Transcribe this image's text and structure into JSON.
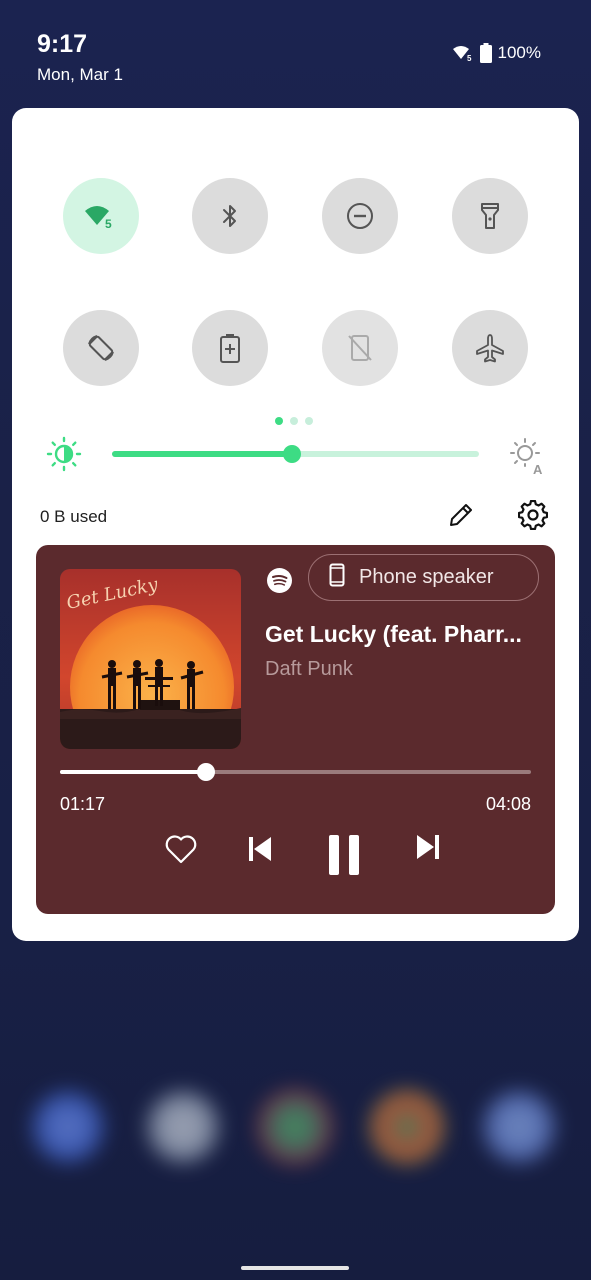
{
  "status_bar": {
    "time": "9:17",
    "date": "Mon, Mar 1",
    "battery": "100%",
    "wifi_badge": "5"
  },
  "quick_settings": {
    "tiles": [
      {
        "name": "wifi",
        "icon": "wifi-5-icon",
        "state": "active",
        "badge": "5"
      },
      {
        "name": "bluetooth",
        "icon": "bluetooth-icon",
        "state": "off"
      },
      {
        "name": "do-not-disturb",
        "icon": "do-not-disturb-icon",
        "state": "off"
      },
      {
        "name": "flashlight",
        "icon": "flashlight-icon",
        "state": "off"
      },
      {
        "name": "auto-rotate",
        "icon": "auto-rotate-icon",
        "state": "off"
      },
      {
        "name": "battery-saver",
        "icon": "battery-saver-icon",
        "state": "off"
      },
      {
        "name": "screen-cast",
        "icon": "screen-cast-icon",
        "state": "disabled"
      },
      {
        "name": "airplane-mode",
        "icon": "airplane-icon",
        "state": "off"
      }
    ],
    "page_index": 1,
    "page_count": 3,
    "brightness_level": 0.49,
    "data_used": "0 B used",
    "accent_color": "#3ddc84"
  },
  "media": {
    "app_icon": "spotify-icon",
    "output_device": "Phone speaker",
    "title": "Get Lucky (feat. Pharr...",
    "artist": "Daft Punk",
    "album_art_text": "Get Lucky",
    "elapsed": "01:17",
    "duration": "04:08",
    "progress": 0.31,
    "card_color": "#5b2a2d"
  }
}
